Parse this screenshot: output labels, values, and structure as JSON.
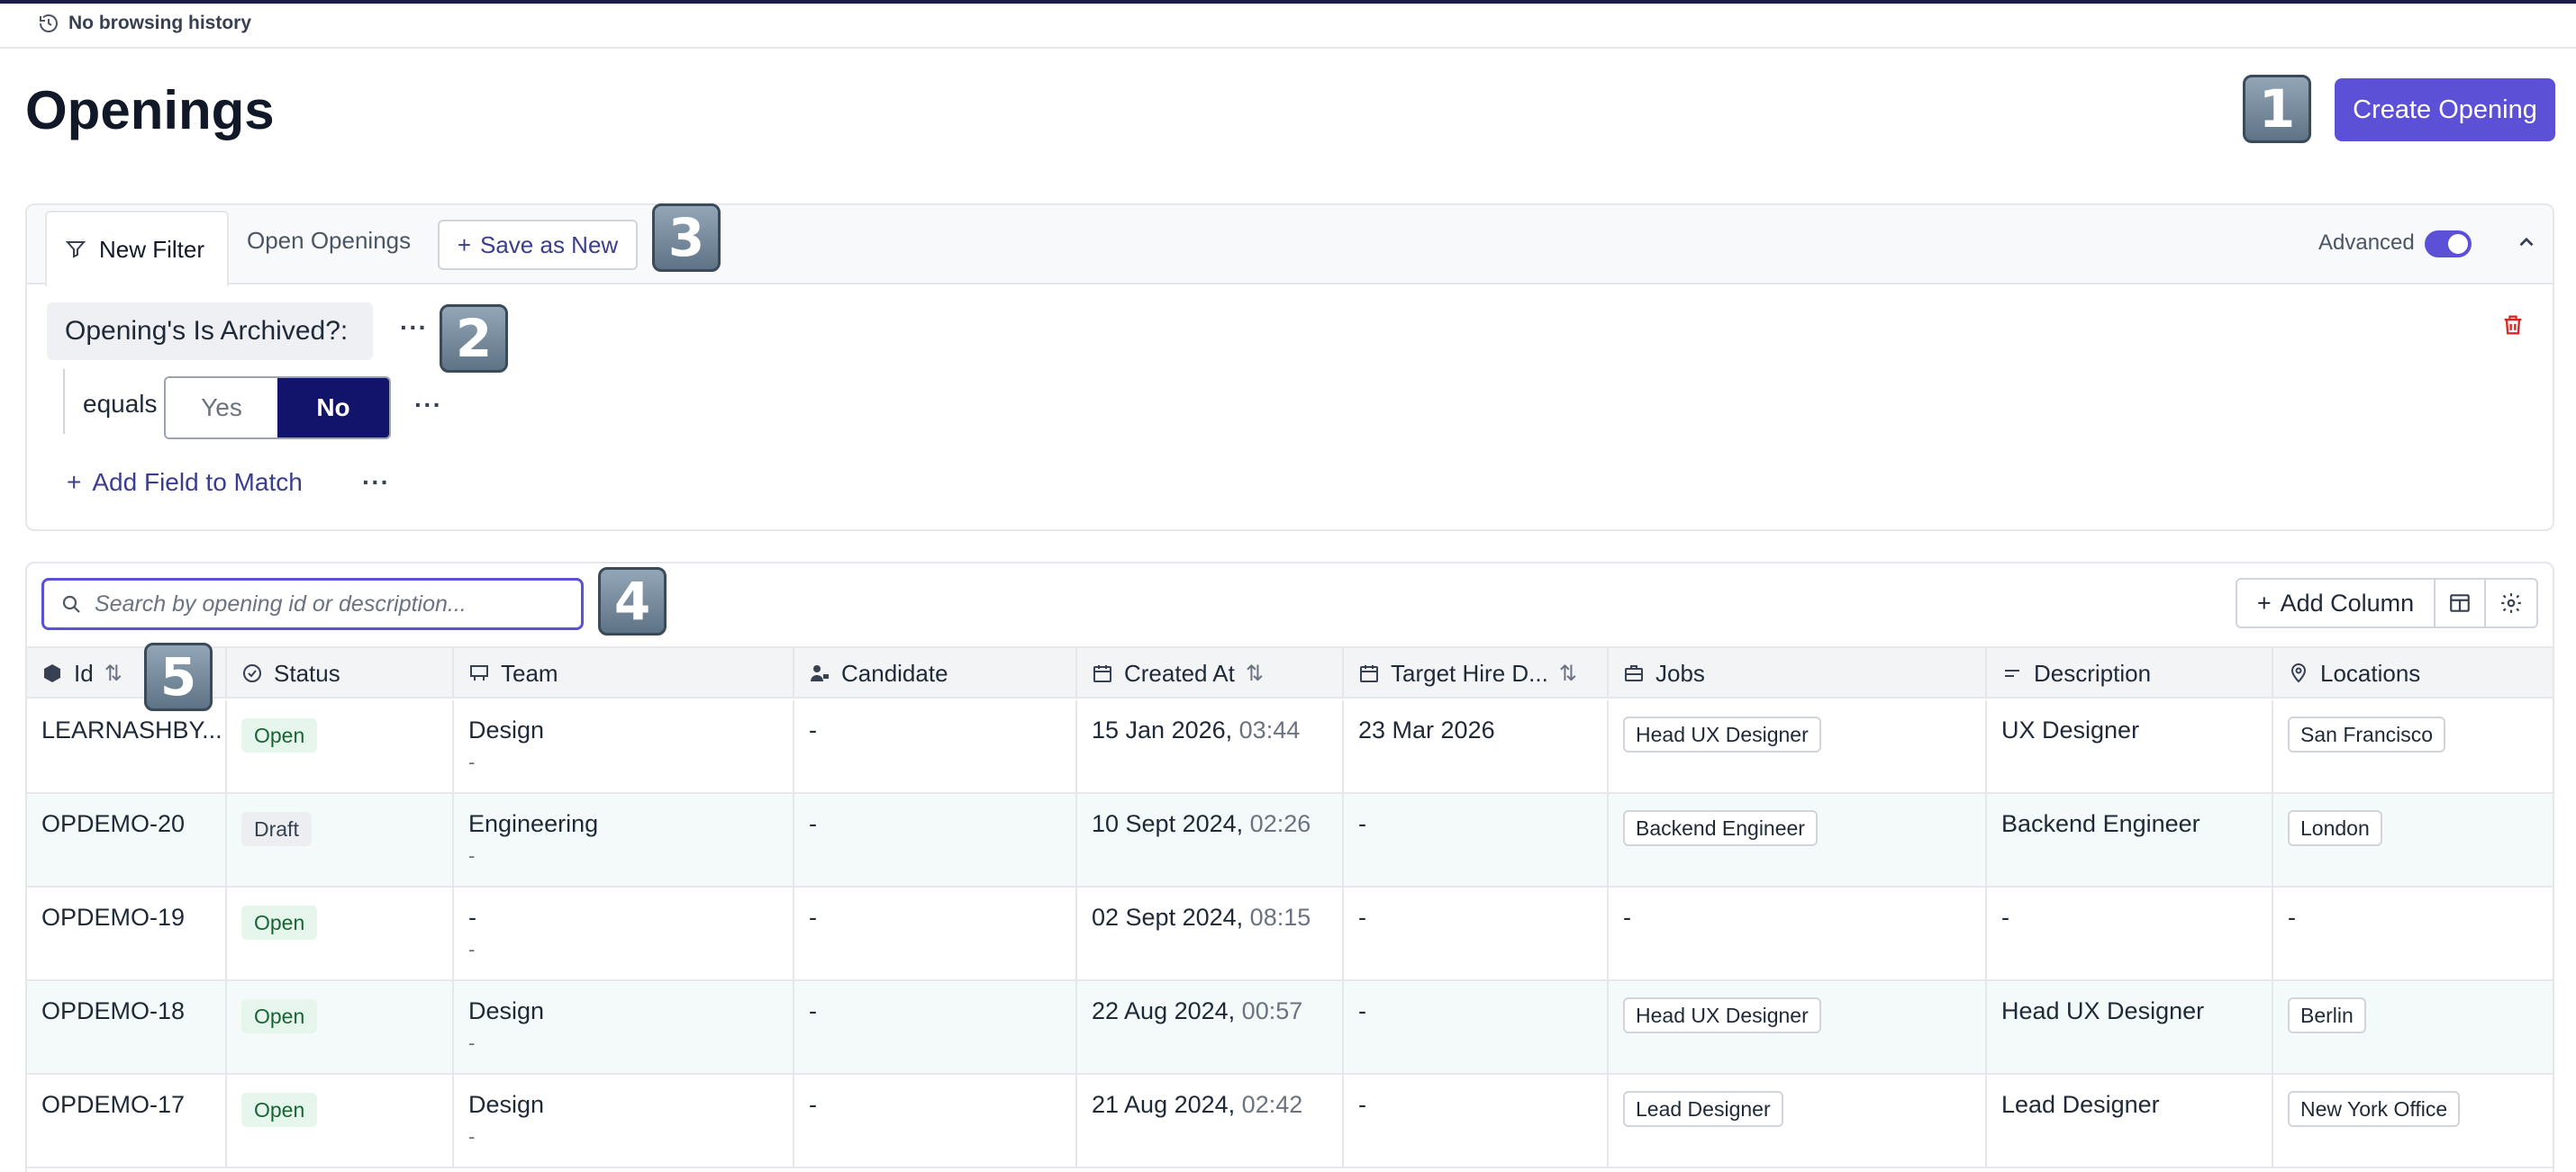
{
  "browser": {
    "history_text": "No browsing history"
  },
  "page": {
    "title": "Openings",
    "create_button": "Create Opening"
  },
  "badges": [
    "1",
    "2",
    "3",
    "4",
    "5"
  ],
  "filter": {
    "tabs": {
      "active": "New Filter",
      "other": "Open Openings"
    },
    "save_as_new": "Save as New",
    "advanced_label": "Advanced",
    "advanced_on": true,
    "field": "Opening's Is Archived?:",
    "operator": "equals",
    "options": {
      "yes": "Yes",
      "no": "No"
    },
    "selected": "No",
    "add_field": "Add Field to Match",
    "more": "···"
  },
  "table": {
    "search_placeholder": "Search by opening id or description...",
    "add_column": "Add Column",
    "columns": {
      "id": "Id",
      "status": "Status",
      "team": "Team",
      "candidate": "Candidate",
      "created_at": "Created At",
      "target_hire": "Target Hire D...",
      "jobs": "Jobs",
      "description": "Description",
      "locations": "Locations"
    },
    "sort_glyph": "⇅",
    "rows": [
      {
        "id": "LEARNASHBY...",
        "status": "Open",
        "team": "Design",
        "team_sub": "-",
        "candidate": "-",
        "created_date": "15 Jan 2026,",
        "created_time": "03:44",
        "target": "23 Mar 2026",
        "job": "Head UX Designer",
        "description": "UX Designer",
        "location": "San Francisco"
      },
      {
        "id": "OPDEMO-20",
        "status": "Draft",
        "team": "Engineering",
        "team_sub": "-",
        "candidate": "-",
        "created_date": "10 Sept 2024,",
        "created_time": "02:26",
        "target": "-",
        "job": "Backend Engineer",
        "description": "Backend Engineer",
        "location": "London"
      },
      {
        "id": "OPDEMO-19",
        "status": "Open",
        "team": "-",
        "team_sub": "-",
        "candidate": "-",
        "created_date": "02 Sept 2024,",
        "created_time": "08:15",
        "target": "-",
        "job": "-",
        "description": "-",
        "location": "-"
      },
      {
        "id": "OPDEMO-18",
        "status": "Open",
        "team": "Design",
        "team_sub": "-",
        "candidate": "-",
        "created_date": "22 Aug 2024,",
        "created_time": "00:57",
        "target": "-",
        "job": "Head UX Designer",
        "description": "Head UX Designer",
        "location": "Berlin"
      },
      {
        "id": "OPDEMO-17",
        "status": "Open",
        "team": "Design",
        "team_sub": "-",
        "candidate": "-",
        "created_date": "21 Aug 2024,",
        "created_time": "02:42",
        "target": "-",
        "job": "Lead Designer",
        "description": "Lead Designer",
        "location": "New York Office"
      }
    ]
  },
  "colors": {
    "accent": "#5b50d6",
    "selected_segment": "#12136b",
    "open_badge_bg": "#e6f6ec",
    "draft_badge_bg": "#eceef1",
    "trash": "#dc2626"
  }
}
